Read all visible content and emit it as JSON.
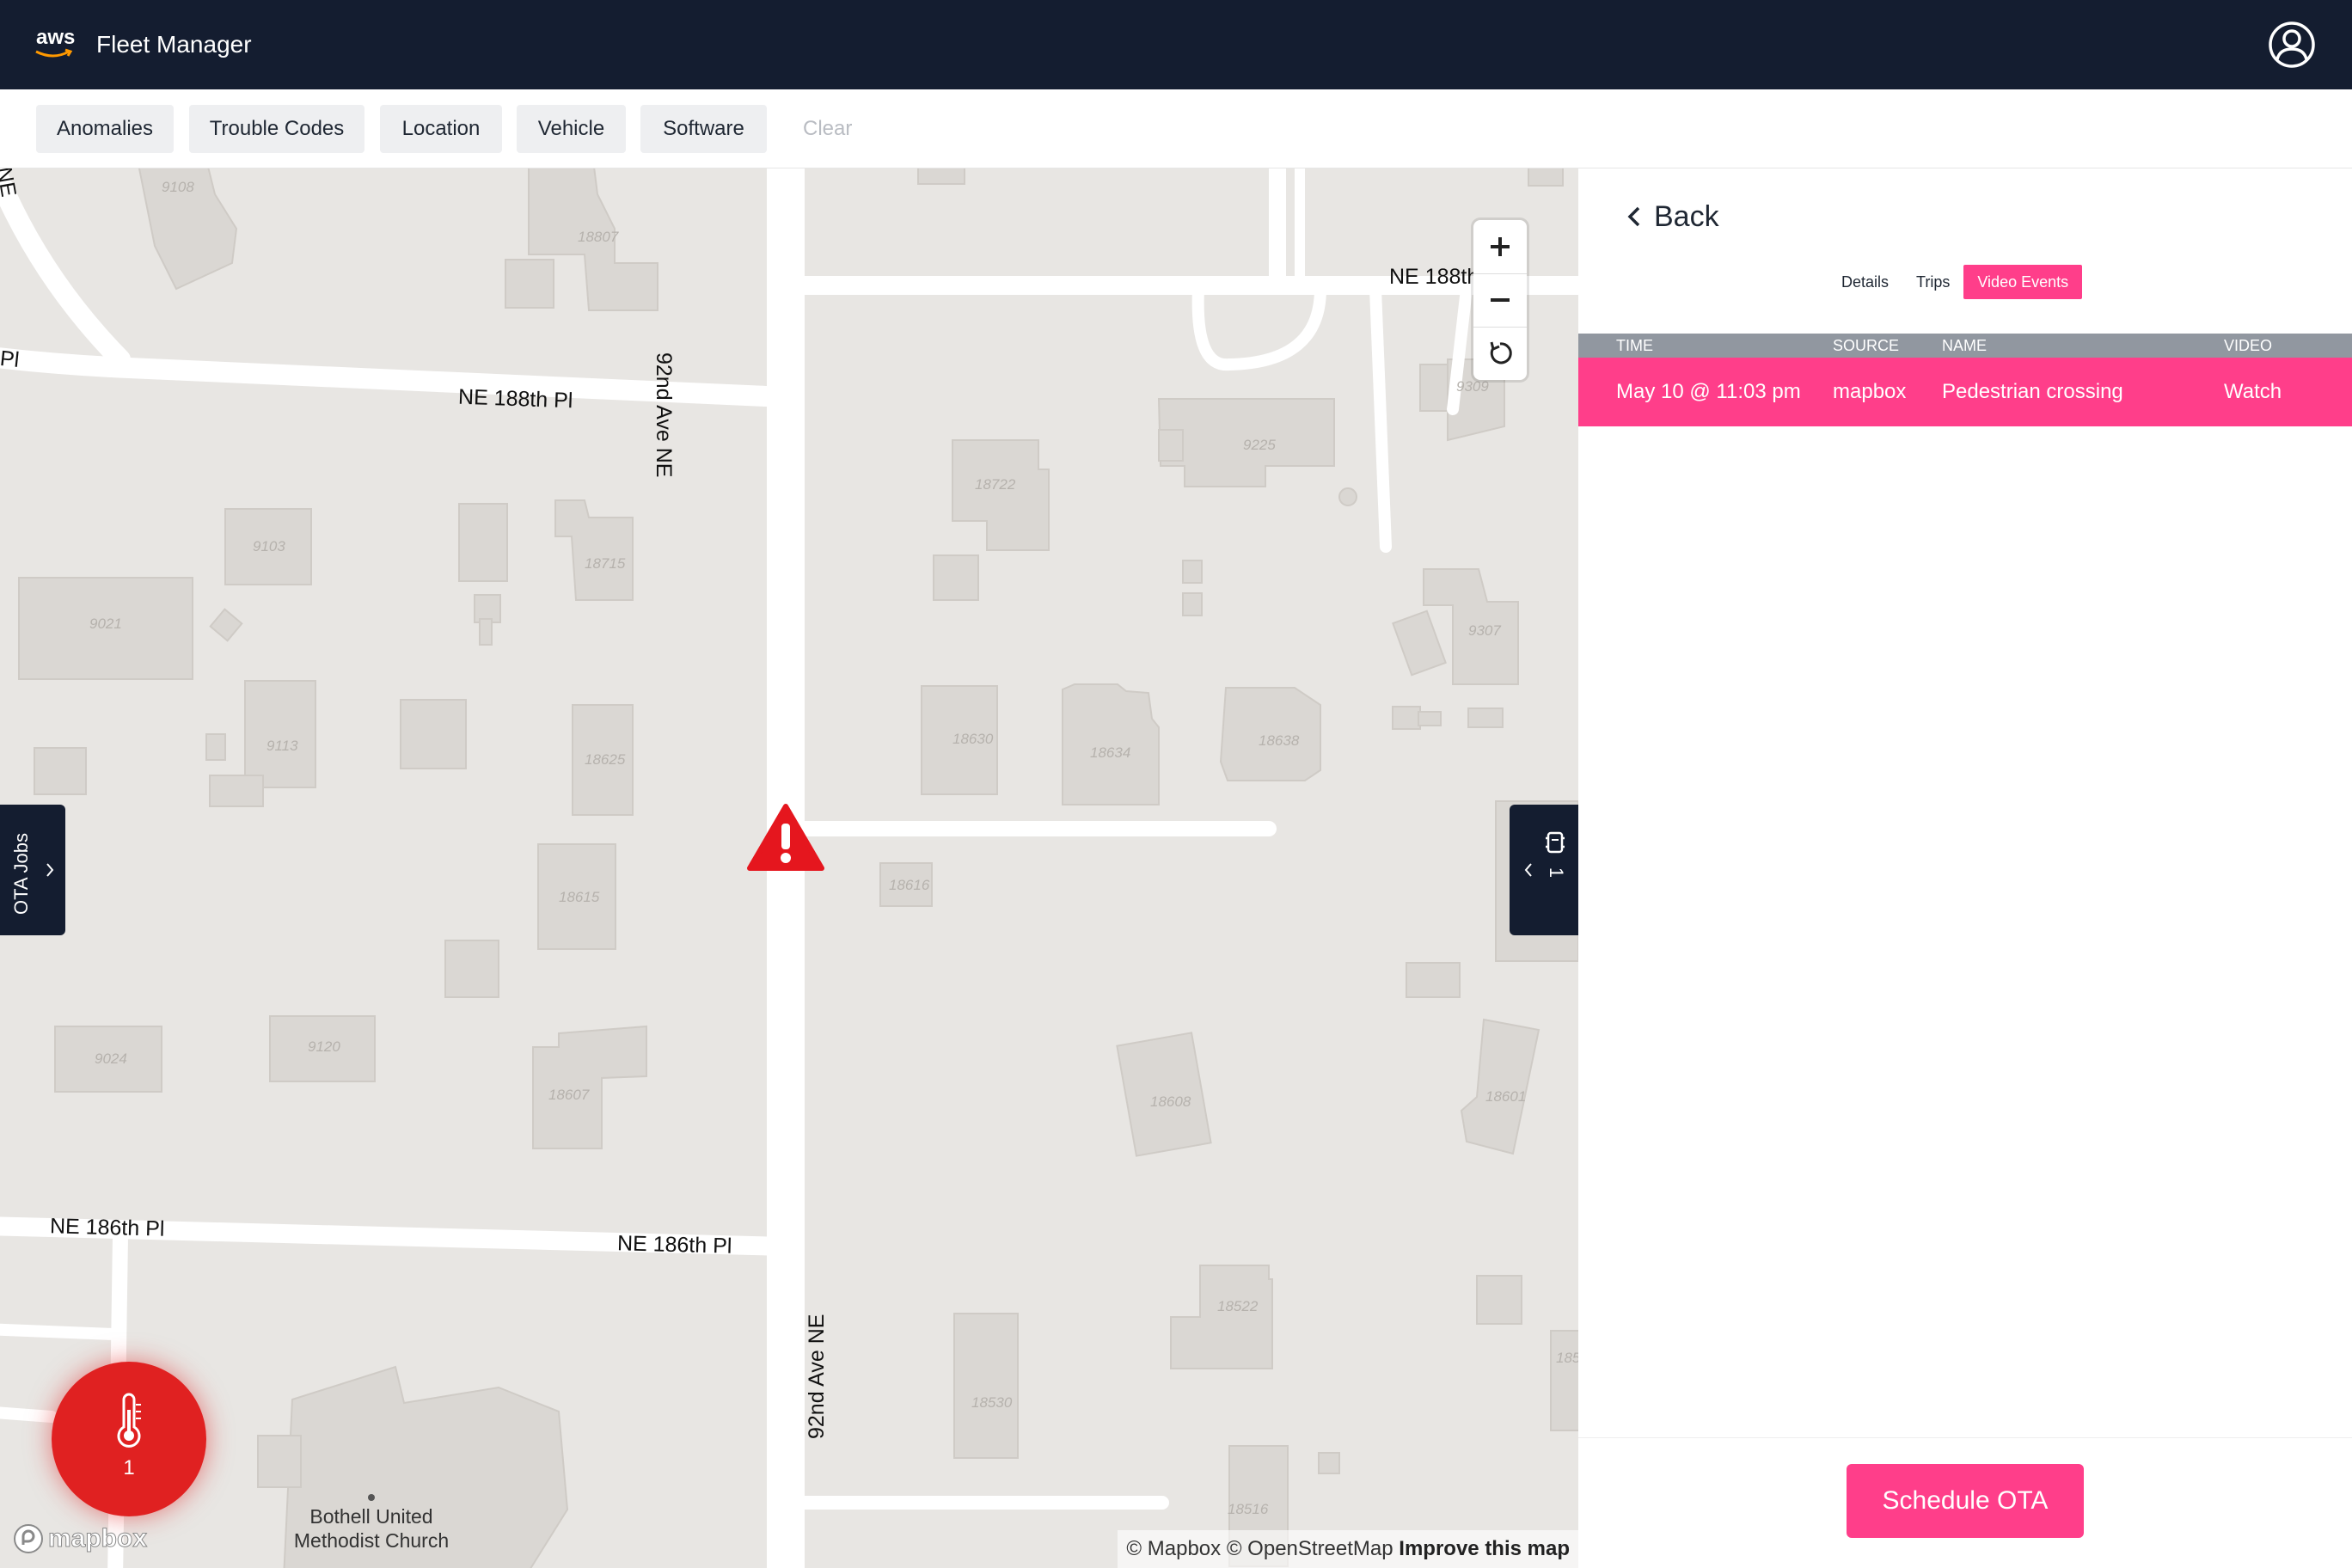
{
  "header": {
    "logo_text": "aws",
    "title": "Fleet Manager",
    "user_icon": "user-circle-icon"
  },
  "filters": {
    "buttons": [
      "Anomalies",
      "Trouble Codes",
      "Location",
      "Vehicle",
      "Software"
    ],
    "clear_label": "Clear"
  },
  "map": {
    "road_labels": {
      "ne_188th_left": "NE 188th Pl",
      "ne_188th_right": "NE 188th",
      "ave_92nd_top": "92nd Ave NE",
      "ave_92nd_bottom": "92nd Ave NE",
      "ne_186th_left": "NE 186th Pl",
      "ne_186th_right": "NE 186th Pl",
      "ne_corner": "NE",
      "pl_left": "Pl"
    },
    "house_numbers": [
      "9108",
      "18807",
      "9103",
      "18715",
      "9021",
      "9113",
      "18625",
      "18615",
      "9024",
      "9120",
      "18607",
      "18722",
      "9225",
      "9309",
      "9307",
      "18630",
      "18634",
      "18638",
      "18616",
      "18608",
      "18601",
      "18522",
      "18530",
      "18516",
      "185"
    ],
    "ota_jobs_label": "OTA Jobs",
    "right_panel_count": "1",
    "temperature_alert_count": "1",
    "poi_label_line1": "Bothell United",
    "poi_label_line2": "Methodist Church",
    "mapbox_logo": "mapbox",
    "attribution": "© Mapbox © OpenStreetMap",
    "improve_link": "Improve this map",
    "marker_icon": "warning-icon"
  },
  "panel": {
    "back_label": "Back",
    "tabs": [
      {
        "label": "Details",
        "active": false
      },
      {
        "label": "Trips",
        "active": false
      },
      {
        "label": "Video Events",
        "active": true
      }
    ],
    "table": {
      "headers": [
        "TIME",
        "SOURCE",
        "NAME",
        "VIDEO"
      ],
      "rows": [
        {
          "time": "May 10 @ 11:03 pm",
          "source": "mapbox",
          "name": "Pedestrian crossing",
          "video": "Watch"
        }
      ]
    },
    "schedule_label": "Schedule OTA"
  },
  "colors": {
    "header_bg": "#141d30",
    "accent_pink": "#ff3e8a",
    "alert_red": "#e02121",
    "map_bg": "#e8e6e3",
    "building": "#d9d6d2"
  }
}
